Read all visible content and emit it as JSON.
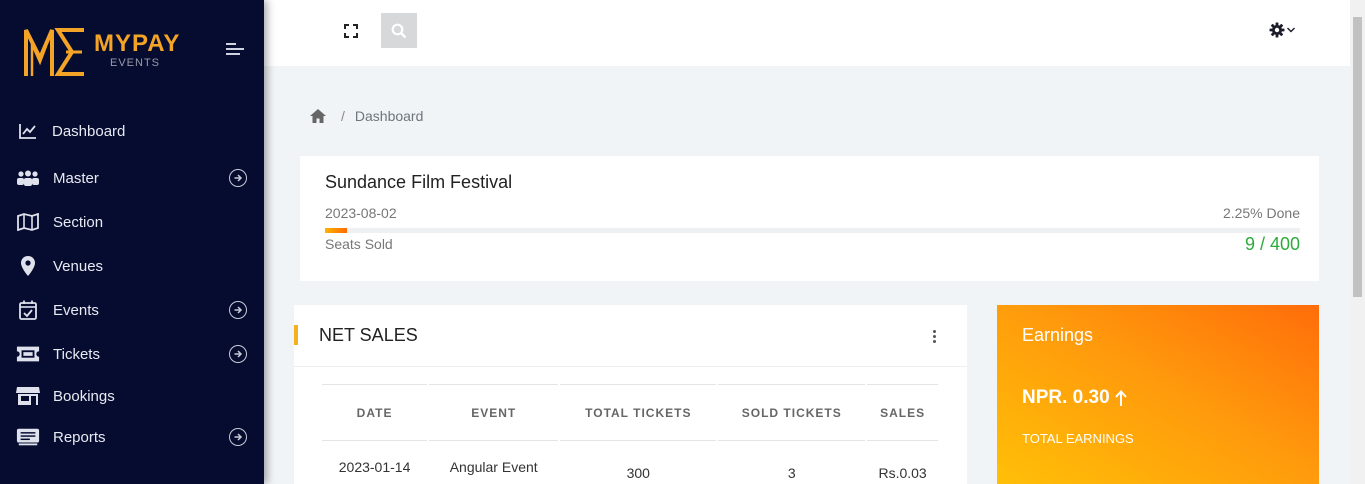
{
  "brand": {
    "name": "MYPAY",
    "sub": "EVENTS"
  },
  "sidebar": {
    "items": [
      {
        "label": "Dashboard",
        "icon": "chart-line-icon",
        "expandable": false
      },
      {
        "label": "Master",
        "icon": "users-icon",
        "expandable": true
      },
      {
        "label": "Section",
        "icon": "map-icon",
        "expandable": false
      },
      {
        "label": "Venues",
        "icon": "map-marker-icon",
        "expandable": false
      },
      {
        "label": "Events",
        "icon": "calendar-check-icon",
        "expandable": true
      },
      {
        "label": "Tickets",
        "icon": "ticket-icon",
        "expandable": true
      },
      {
        "label": "Bookings",
        "icon": "store-icon",
        "expandable": false
      },
      {
        "label": "Reports",
        "icon": "report-icon",
        "expandable": true
      }
    ]
  },
  "breadcrumb": {
    "separator": "/",
    "current": "Dashboard"
  },
  "event": {
    "title": "Sundance Film Festival",
    "date": "2023-08-02",
    "progress_text": "2.25% Done",
    "progress_fraction": 0.0225,
    "seats_label": "Seats Sold",
    "seats_value": "9 / 400"
  },
  "net_sales": {
    "title": "NET SALES",
    "columns": [
      "DATE",
      "EVENT",
      "TOTAL TICKETS",
      "SOLD TICKETS",
      "SALES"
    ],
    "rows": [
      [
        "2023-01-14",
        "Angular Event",
        "300",
        "3",
        "Rs.0.03"
      ]
    ]
  },
  "earnings": {
    "title": "Earnings",
    "value": "NPR. 0.30",
    "label": "TOTAL EARNINGS",
    "trend_icon": "arrow-up-icon"
  },
  "colors": {
    "sidebar_bg": "#050c2f",
    "brand_gold": "#f3a326",
    "accent_green": "#2eaa3c",
    "earnings_gradient_start": "#ffc107",
    "earnings_gradient_end": "#ff6d0a"
  }
}
